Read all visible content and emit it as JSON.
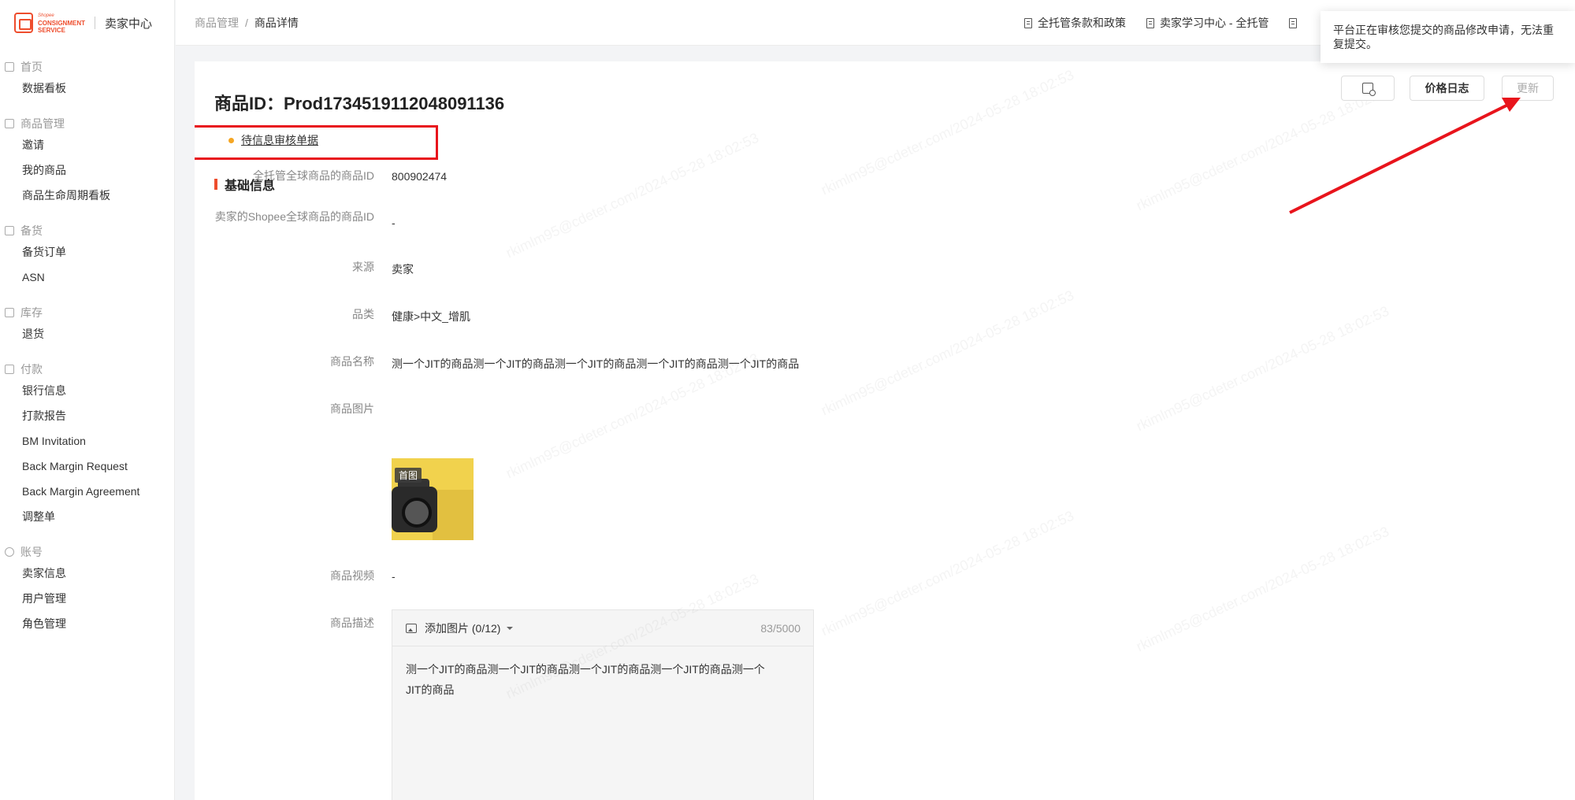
{
  "sidebar": {
    "logo_small": "Shopee",
    "logo_line1": "CONSIGNMENT",
    "logo_line2": "SERVICE",
    "title": "卖家中心",
    "groups": [
      {
        "title": "首页",
        "items": [
          "数据看板"
        ]
      },
      {
        "title": "商品管理",
        "items": [
          "邀请",
          "我的商品",
          "商品生命周期看板"
        ]
      },
      {
        "title": "备货",
        "items": [
          "备货订单",
          "ASN"
        ]
      },
      {
        "title": "库存",
        "items": [
          "退货"
        ]
      },
      {
        "title": "付款",
        "items": [
          "银行信息",
          "打款报告",
          "BM Invitation",
          "Back Margin Request",
          "Back Margin Agreement",
          "调整单"
        ]
      },
      {
        "title": "账号",
        "items": [
          "卖家信息",
          "用户管理",
          "角色管理"
        ]
      }
    ]
  },
  "header": {
    "breadcrumb_parent": "商品管理",
    "breadcrumb_sep": "/",
    "breadcrumb_current": "商品详情",
    "link1": "全托管条款和政策",
    "link2": "卖家学习中心 - 全托管"
  },
  "tooltip": "平台正在审核您提交的商品修改申请，无法重复提交。",
  "buttons": {
    "price_log": "价格日志",
    "update": "更新"
  },
  "product": {
    "title": "商品ID：Prod1734519112048091136",
    "audit_link": "待信息审核单据",
    "section": "基础信息",
    "fields": {
      "global_id_label": "全托管全球商品的商品ID",
      "global_id_value": "800902474",
      "seller_id_label": "卖家的Shopee全球商品的商品ID",
      "seller_id_value": "-",
      "source_label": "来源",
      "source_value": "卖家",
      "category_label": "品类",
      "category_value": "健康>中文_增肌",
      "name_label": "商品名称",
      "name_value": "测一个JIT的商品测一个JIT的商品测一个JIT的商品测一个JIT的商品测一个JIT的商品",
      "image_label": "商品图片",
      "image_badge": "首图",
      "video_label": "商品视频",
      "video_value": "-",
      "desc_label": "商品描述"
    },
    "editor": {
      "add_image": "添加图片 (0/12)",
      "counter": "83/5000",
      "content": "测一个JIT的商品测一个JIT的商品测一个JIT的商品测一个JIT的商品测一个JIT的商品"
    }
  },
  "colors": {
    "accent": "#ee4d2d",
    "highlight": "#e8141c",
    "dot": "#f5a623"
  }
}
